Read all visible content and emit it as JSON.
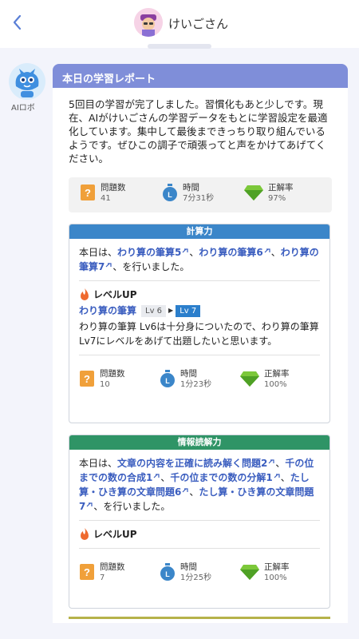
{
  "header": {
    "title": "けいごさん"
  },
  "bot": {
    "label": "AIロボ"
  },
  "report": {
    "title": "本日の学習レポート",
    "intro": "5回目の学習が完了しました。習慣化もあと少しです。現在、AIがけいごさんの学習データをもとに学習設定を最適化しています。集中して最後まできっちり取り組んでいるようです。ぜひこの調子で頑張ってと声をかけてあげてください。",
    "stats": {
      "questions_label": "問題数",
      "questions": "41",
      "time_label": "時間",
      "time": "7分31秒",
      "accuracy_label": "正解率",
      "accuracy": "97%"
    }
  },
  "sections": [
    {
      "title": "計算力",
      "color": "#3b86c9",
      "pre": "本日は、",
      "items": [
        "わり算の筆算5",
        "わり算の筆算6",
        "わり算の筆算7"
      ],
      "post": "を行いました。",
      "levelup_label": "レベルUP",
      "lv_item": "わり算の筆算",
      "lv_from": "Lv 6",
      "lv_to": "Lv 7",
      "lv_desc": "わり算の筆算 Lv6は十分身についたので、わり算の筆算 Lv7にレベルをあげて出題したいと思います。",
      "questions": "10",
      "time": "1分23秒",
      "accuracy": "100%"
    },
    {
      "title": "情報読解力",
      "color": "#2f9466",
      "pre": "本日は、",
      "items": [
        "文章の内容を正確に読み解く問題2",
        "千の位までの数の合成1",
        "千の位までの数の分解1",
        "たし算・ひき算の文章問題6",
        "たし算・ひき算の文章問題7"
      ],
      "post": "を行いました。",
      "levelup_label": "レベルUP",
      "questions": "7",
      "time": "1分25秒",
      "accuracy": "100%"
    }
  ]
}
